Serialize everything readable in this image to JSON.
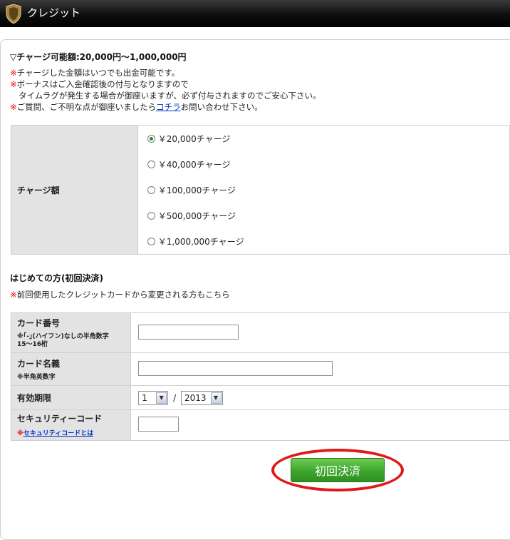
{
  "header": {
    "title": "クレジット",
    "icon": "shield-icon"
  },
  "charge": {
    "heading": "▽チャージ可能額:20,000円～1,000,000円",
    "notes": {
      "line1": "チャージした金額はいつでも出金可能です。",
      "line2": "ボーナスはご入金確認後の付与となりますので",
      "line3": "タイムラグが発生する場合が御座いますが、必ず付与されますのでご安心下さい。",
      "line4_before": "ご質問、ご不明な点が御座いましたら",
      "line4_link": "コチラ",
      "line4_after": "お問い合わせ下さい。",
      "mark": "※"
    },
    "label": "チャージ額",
    "options": [
      "￥20,000チャージ",
      "￥40,000チャージ",
      "￥100,000チャージ",
      "￥500,000チャージ",
      "￥1,000,000チャージ"
    ],
    "selected_option": "￥20,000チャージ"
  },
  "first_payment": {
    "heading": "はじめての方(初回決済)",
    "note": "前回使用したクレジットカードから変更される方もこちら",
    "mark": "※",
    "card_number": {
      "label": "カード番号",
      "hint_line1": "※｢-｣(ハイフン)なしの半角数字",
      "hint_line2": "15～16桁",
      "value": ""
    },
    "card_name": {
      "label": "カード名義",
      "hint": "※半角英数字",
      "value": ""
    },
    "expiry": {
      "label": "有効期限",
      "month": "1",
      "separator": "/",
      "year": "2013"
    },
    "security": {
      "label": "セキュリティーコード",
      "mark": "※",
      "link": "セキュリティコードとは",
      "value": ""
    }
  },
  "submit": {
    "label": "初回決済",
    "highlight_color": "#e01818",
    "button_color": "#3da62c"
  }
}
